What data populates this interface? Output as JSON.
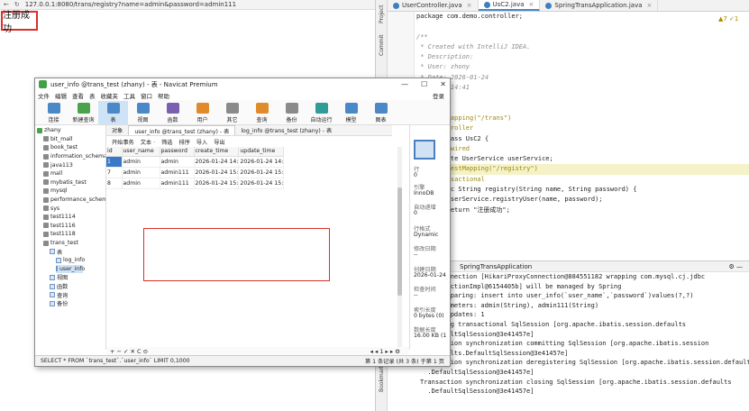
{
  "browser": {
    "url": "127.0.0.1:8080/trans/registry?name=admin&password=admin111",
    "page_text": "注册成功"
  },
  "ide": {
    "side_tabs": [
      "Project",
      "Commit",
      "Bookmarks"
    ],
    "tabs": [
      {
        "label": "UserController.java"
      },
      {
        "label": "UsC2.java",
        "active": true
      },
      {
        "label": "SpringTransApplication.java"
      }
    ],
    "warn_badge": "▲7 ✓1",
    "code_lines": [
      "package com.demo.controller;",
      "",
      "/**",
      " * Created with IntelliJ IDEA.",
      " * Description:",
      " * User: zhony",
      " * Date: 2026-01-24",
      " * Time: 14:41",
      " */",
      "",
      "@RequestMapping(\"/trans\")",
      "@RestController",
      "public class UsC2 {",
      "    @Autowired",
      "    private UserService userService;",
      "    @RequestMapping(\"/registry\")",
      "    @Transactional",
      "    public String registry(String name, String password) {",
      "        userService.registryUser(name, password);",
      "        return \"注册成功\";",
      "    }",
      "}"
    ],
    "run_title": "SpringTransApplication",
    "console_lines": [
      "JDBC Connection [HikariProxyConnection@884551182 wrapping com.mysql.cj.jdbc",
      "  .ConnectionImpl@6154405b] will be managed by Spring",
      "==>  Preparing: insert into user_info(`user_name`,`password`)values(?,?)",
      "==> Parameters: admin(String), admin111(String)",
      "<==    Updates: 1",
      "Releasing transactional SqlSession [org.apache.ibatis.session.defaults",
      "  .DefaultSqlSession@3e41457e]",
      "Transaction synchronization committing SqlSession [org.apache.ibatis.session",
      "  .defaults.DefaultSqlSession@3e41457e]",
      "Transaction synchronization deregistering SqlSession [org.apache.ibatis.session.defaults",
      "  .DefaultSqlSession@3e41457e]",
      "Transaction synchronization closing SqlSession [org.apache.ibatis.session.defaults",
      "  .DefaultSqlSession@3e41457e]"
    ]
  },
  "navicat": {
    "title": "user_info @trans_test (zhany) - 表 - Navicat Premium",
    "menu": [
      "文件",
      "编辑",
      "查看",
      "表",
      "收藏夹",
      "工具",
      "窗口",
      "帮助"
    ],
    "login": "登录",
    "toolbar": [
      "连接",
      "新建查询",
      "表",
      "视图",
      "函数",
      "用户",
      "其它",
      "查询",
      "备份",
      "自动运行",
      "模型",
      "图表"
    ],
    "tree": [
      {
        "label": "zhany",
        "level": 0,
        "type": "conn"
      },
      {
        "label": "bit_mall",
        "level": 1,
        "type": "db"
      },
      {
        "label": "book_test",
        "level": 1,
        "type": "db"
      },
      {
        "label": "information_schema",
        "level": 1,
        "type": "db"
      },
      {
        "label": "java113",
        "level": 1,
        "type": "db"
      },
      {
        "label": "mall",
        "level": 1,
        "type": "db"
      },
      {
        "label": "mybatis_test",
        "level": 1,
        "type": "db"
      },
      {
        "label": "mysql",
        "level": 1,
        "type": "db"
      },
      {
        "label": "performance_schem",
        "level": 1,
        "type": "db"
      },
      {
        "label": "sys",
        "level": 1,
        "type": "db"
      },
      {
        "label": "test1114",
        "level": 1,
        "type": "db"
      },
      {
        "label": "test1116",
        "level": 1,
        "type": "db"
      },
      {
        "label": "test1118",
        "level": 1,
        "type": "db"
      },
      {
        "label": "trans_test",
        "level": 1,
        "type": "db"
      },
      {
        "label": "表",
        "level": 2,
        "type": "folder"
      },
      {
        "label": "log_info",
        "level": 3,
        "type": "tbl"
      },
      {
        "label": "user_info",
        "level": 3,
        "type": "tbl",
        "selected": true
      },
      {
        "label": "视图",
        "level": 2,
        "type": "folder"
      },
      {
        "label": "函数",
        "level": 2,
        "type": "folder"
      },
      {
        "label": "查询",
        "level": 2,
        "type": "folder"
      },
      {
        "label": "备份",
        "level": 2,
        "type": "folder"
      }
    ],
    "obj_tabs": [
      {
        "label": "对象"
      },
      {
        "label": "user_info @trans_test (zhany) - 表",
        "active": true
      },
      {
        "label": "log_info @trans_test (zhany) - 表"
      }
    ],
    "grid_toolbar": [
      "开始事务",
      "文本 ·",
      "筛选",
      "排序",
      "导入",
      "导出"
    ],
    "columns": [
      "id",
      "user_name",
      "password",
      "create_time",
      "update_time"
    ],
    "rows": [
      [
        "1",
        "admin",
        "admin",
        "2026-01-24 14:",
        "2026-01-24 14:"
      ],
      [
        "7",
        "admin",
        "admin111",
        "2026-01-24 15:",
        "2026-01-24 15:"
      ],
      [
        "8",
        "admin",
        "admin111",
        "2026-01-24 15:",
        "2026-01-24 15:"
      ]
    ],
    "info": {
      "rows_k": "行",
      "rows_v": "0",
      "engine_k": "引擎",
      "engine_v": "InnoDB",
      "autoinc_k": "自动递增",
      "autoinc_v": "0",
      "rowfmt_k": "行格式",
      "rowfmt_v": "Dynamic",
      "modified_k": "修改日期",
      "modified_v": "--",
      "created_k": "创建日期",
      "created_v": "2026-01-24",
      "checked_k": "检查时间",
      "checked_v": "--",
      "idx_k": "索引长度",
      "idx_v": "0 bytes (0)",
      "data_k": "数据长度",
      "data_v": "16.00 KB (1"
    },
    "nav_controls": "+ − ✓ ✕ C ⊝",
    "pager": "◂ ◂ 1 ▸ ▸ ⚙",
    "status_sql": "SELECT * FROM `trans_test`.`user_info` LIMIT 0,1000",
    "status_rec": "第 1 条记录 (共 3 条) 于第 1 页"
  }
}
